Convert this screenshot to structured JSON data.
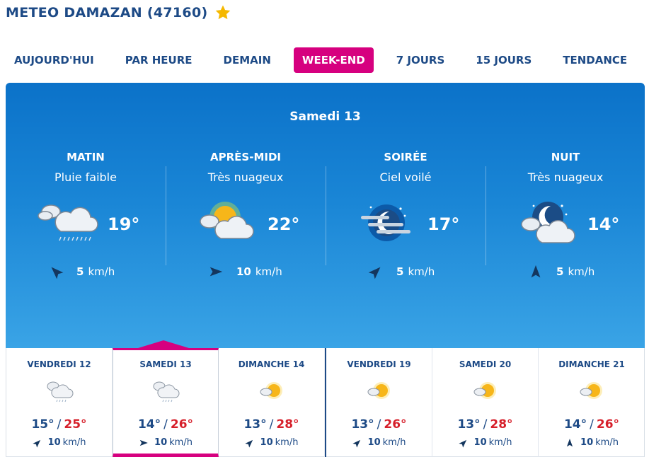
{
  "header": {
    "title": "METEO DAMAZAN (47160)",
    "favorite_icon": "star-icon",
    "star_color": "#f5b800"
  },
  "tabs": [
    {
      "label": "AUJOURD'HUI",
      "active": false
    },
    {
      "label": "PAR HEURE",
      "active": false
    },
    {
      "label": "DEMAIN",
      "active": false
    },
    {
      "label": "WEEK-END",
      "active": true
    },
    {
      "label": "7 JOURS",
      "active": false
    },
    {
      "label": "15 JOURS",
      "active": false
    },
    {
      "label": "TENDANCE",
      "active": false
    }
  ],
  "colors": {
    "accent": "#d6007f",
    "max_temp": "#d61f2a",
    "text": "#1d4a86",
    "panel_top": "#0b72c9",
    "panel_bottom": "#3aa4e6"
  },
  "main": {
    "day": "Samedi 13",
    "periods": [
      {
        "name": "MATIN",
        "desc": "Pluie faible",
        "temp": "19°",
        "wind_speed": "5",
        "wind_unit": "km/h",
        "icon": "cloud-rain-icon",
        "wind_dir_deg": 315
      },
      {
        "name": "APRÈS-MIDI",
        "desc": "Très nuageux",
        "temp": "22°",
        "wind_speed": "10",
        "wind_unit": "km/h",
        "icon": "sun-cloud-icon",
        "wind_dir_deg": 90
      },
      {
        "name": "SOIRÉE",
        "desc": "Ciel voilé",
        "temp": "17°",
        "wind_speed": "5",
        "wind_unit": "km/h",
        "icon": "moon-haze-icon",
        "wind_dir_deg": 45
      },
      {
        "name": "NUIT",
        "desc": "Très nuageux",
        "temp": "14°",
        "wind_speed": "5",
        "wind_unit": "km/h",
        "icon": "moon-cloud-icon",
        "wind_dir_deg": 0
      }
    ]
  },
  "days": [
    {
      "label": "VENDREDI 12",
      "min": "15°",
      "max": "25°",
      "sep": "/",
      "wind_speed": "10",
      "wind_unit": "km/h",
      "icon": "cloud-rain-icon",
      "wind_dir_deg": 45,
      "selected": false
    },
    {
      "label": "SAMEDI 13",
      "min": "14°",
      "max": "26°",
      "sep": "/",
      "wind_speed": "10",
      "wind_unit": "km/h",
      "icon": "cloud-rain-icon",
      "wind_dir_deg": 90,
      "selected": true
    },
    {
      "label": "DIMANCHE 14",
      "min": "13°",
      "max": "28°",
      "sep": "/",
      "wind_speed": "10",
      "wind_unit": "km/h",
      "icon": "sun-cloud-icon",
      "wind_dir_deg": 45,
      "selected": false
    },
    {
      "label": "VENDREDI 19",
      "min": "13°",
      "max": "26°",
      "sep": "/",
      "wind_speed": "10",
      "wind_unit": "km/h",
      "icon": "sun-cloud-icon",
      "wind_dir_deg": 45,
      "selected": false
    },
    {
      "label": "SAMEDI 20",
      "min": "13°",
      "max": "28°",
      "sep": "/",
      "wind_speed": "10",
      "wind_unit": "km/h",
      "icon": "sun-cloud-icon",
      "wind_dir_deg": 45,
      "selected": false
    },
    {
      "label": "DIMANCHE 21",
      "min": "14°",
      "max": "26°",
      "sep": "/",
      "wind_speed": "10",
      "wind_unit": "km/h",
      "icon": "sun-cloud-icon",
      "wind_dir_deg": 0,
      "selected": false
    }
  ]
}
